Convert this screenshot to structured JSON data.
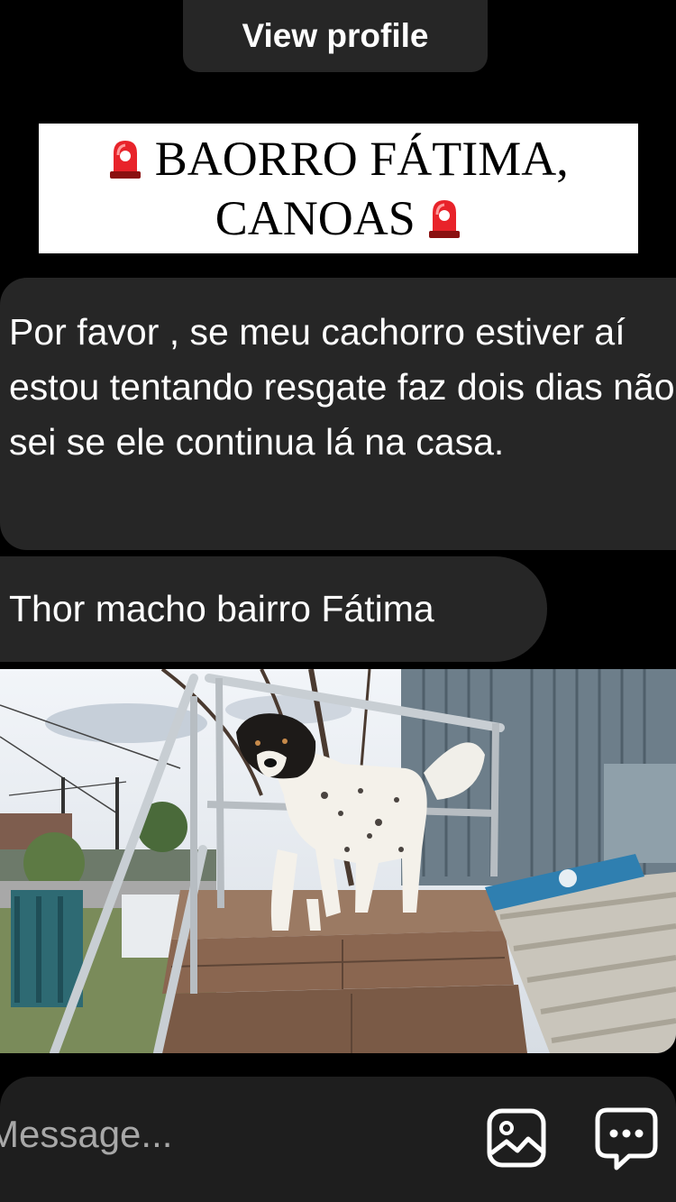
{
  "header": {
    "view_profile_label": "View profile"
  },
  "banner": {
    "line1_text": "BAORRO FÁTIMA,",
    "line2_text": "CANOAS"
  },
  "messages": [
    {
      "text": "Por favor , se meu cachorro estiver aí estou tentando resgate faz dois dias não sei se ele continua lá na casa."
    },
    {
      "text": "Thor macho bairro Fátima"
    }
  ],
  "composer": {
    "placeholder": "Message...",
    "gallery_icon": "image-icon",
    "sticker_icon": "chat-bubble-dots-icon"
  },
  "colors": {
    "bubble": "#262626",
    "composer": "#1e1e1e",
    "siren": "#e8232a"
  }
}
